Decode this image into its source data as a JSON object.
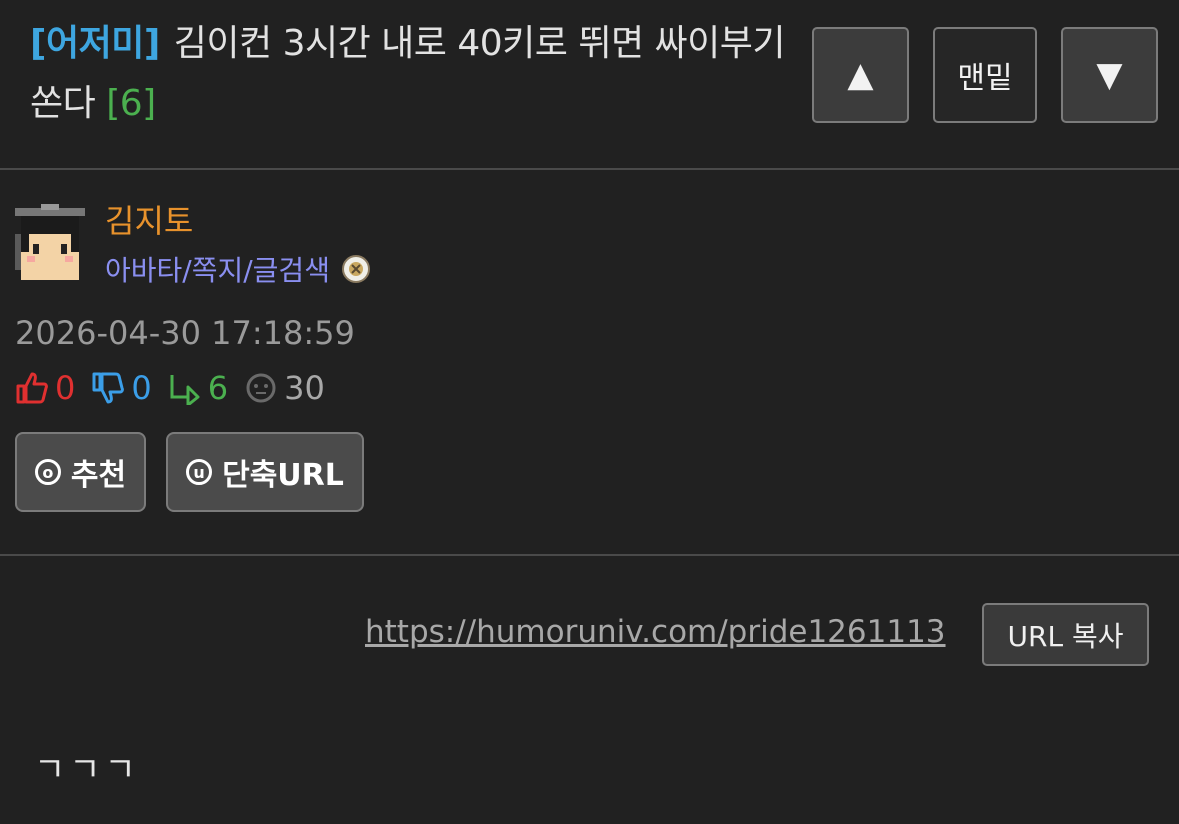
{
  "post": {
    "category": "[어저미]",
    "title": "김이컨 3시간 내로 40키로 뛰면 싸이부기 쏜다",
    "comment_count": "[6]"
  },
  "nav": {
    "up_label": "▲",
    "bottom_label": "맨밑",
    "down_label": "▼"
  },
  "author": {
    "nickname": "김지토",
    "links": "아바타/쪽지/글검색"
  },
  "meta": {
    "date": "2026-04-30 17:18:59",
    "recommend": "0",
    "oppose": "0",
    "replies": "6",
    "views": "30"
  },
  "actions": {
    "recommend_label": "추천",
    "short_url_label": "단축URL"
  },
  "url": {
    "link": "https://humoruniv.com/pride1261113",
    "copy_label": "URL 복사"
  },
  "body": {
    "text": "ㄱㄱㄱ"
  },
  "colors": {
    "background": "#212121",
    "category": "#3ea6e0",
    "comment_count": "#4bb04f",
    "nickname": "#e8922c",
    "links": "#8a8ff0",
    "recommend": "#e03030",
    "oppose": "#3b9ee8",
    "replies": "#4bb04f"
  },
  "icons": [
    "thumbs-up-icon",
    "thumbs-down-icon",
    "reply-icon",
    "view-icon",
    "medal-icon",
    "avatar-icon"
  ]
}
